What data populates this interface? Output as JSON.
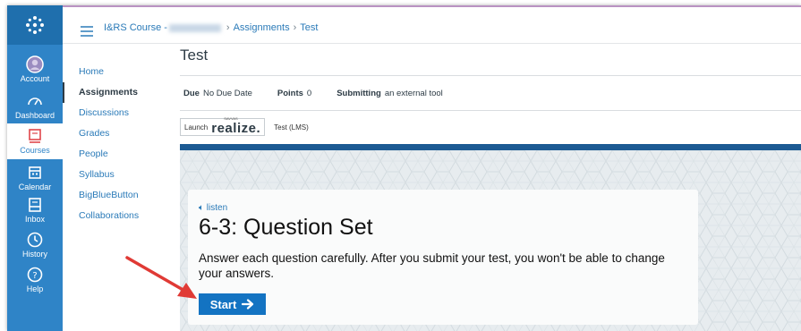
{
  "global_nav": {
    "items": [
      {
        "label": "Account",
        "icon": "account-avatar-icon"
      },
      {
        "label": "Dashboard",
        "icon": "dashboard-icon"
      },
      {
        "label": "Courses",
        "icon": "courses-icon"
      },
      {
        "label": "Calendar",
        "icon": "calendar-icon"
      },
      {
        "label": "Inbox",
        "icon": "inbox-icon"
      },
      {
        "label": "History",
        "icon": "history-icon"
      },
      {
        "label": "Help",
        "icon": "help-icon"
      }
    ],
    "active": "Courses"
  },
  "breadcrumbs": {
    "course": "I&RS Course -",
    "assignments": "Assignments",
    "current": "Test"
  },
  "course_nav": {
    "items": [
      "Home",
      "Assignments",
      "Discussions",
      "Grades",
      "People",
      "Syllabus",
      "BigBlueButton",
      "Collaborations"
    ],
    "active": "Assignments"
  },
  "page": {
    "title": "Test",
    "due_label": "Due",
    "due_value": "No Due Date",
    "points_label": "Points",
    "points_value": "0",
    "submitting_label": "Submitting",
    "submitting_value": "an external tool"
  },
  "tool": {
    "launch_label": "Launch",
    "brand_small": "SAVVAS",
    "brand": "realize.",
    "tool_label": "Test (LMS)"
  },
  "embed": {
    "listen": "listen",
    "title": "6-3: Question Set",
    "description": "Answer each question carefully. After you submit your test, you won't be able to change your answers.",
    "start_label": "Start"
  },
  "colors": {
    "nav_blue": "#2f84c7",
    "link_blue": "#2a7ab8",
    "start_blue": "#1373c2",
    "annotation_red": "#e03a35"
  }
}
